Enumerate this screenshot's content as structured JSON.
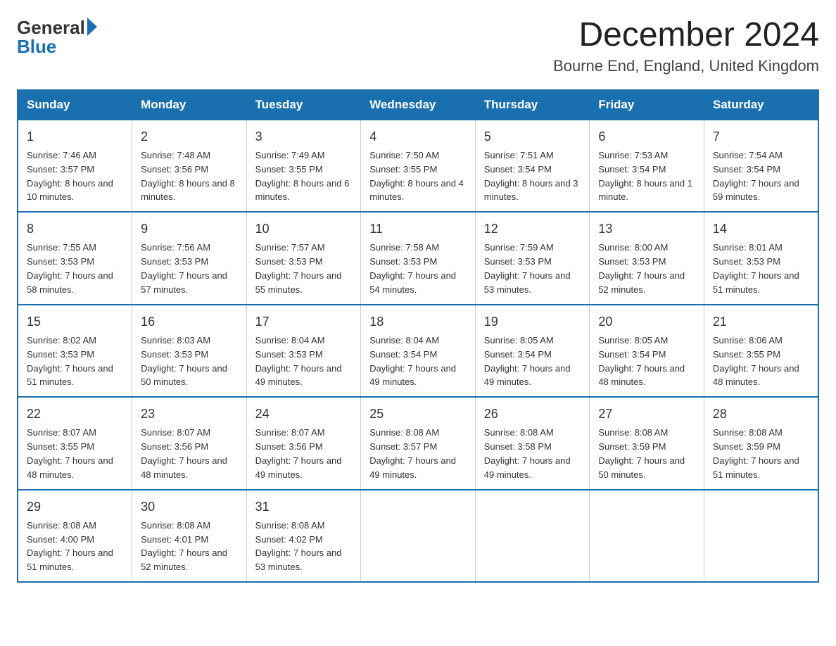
{
  "logo": {
    "general": "General",
    "blue": "Blue",
    "arrow": "▶"
  },
  "header": {
    "month_title": "December 2024",
    "location": "Bourne End, England, United Kingdom"
  },
  "days_of_week": [
    "Sunday",
    "Monday",
    "Tuesday",
    "Wednesday",
    "Thursday",
    "Friday",
    "Saturday"
  ],
  "weeks": [
    [
      {
        "day": "1",
        "sunrise": "7:46 AM",
        "sunset": "3:57 PM",
        "daylight": "8 hours and 10 minutes."
      },
      {
        "day": "2",
        "sunrise": "7:48 AM",
        "sunset": "3:56 PM",
        "daylight": "8 hours and 8 minutes."
      },
      {
        "day": "3",
        "sunrise": "7:49 AM",
        "sunset": "3:55 PM",
        "daylight": "8 hours and 6 minutes."
      },
      {
        "day": "4",
        "sunrise": "7:50 AM",
        "sunset": "3:55 PM",
        "daylight": "8 hours and 4 minutes."
      },
      {
        "day": "5",
        "sunrise": "7:51 AM",
        "sunset": "3:54 PM",
        "daylight": "8 hours and 3 minutes."
      },
      {
        "day": "6",
        "sunrise": "7:53 AM",
        "sunset": "3:54 PM",
        "daylight": "8 hours and 1 minute."
      },
      {
        "day": "7",
        "sunrise": "7:54 AM",
        "sunset": "3:54 PM",
        "daylight": "7 hours and 59 minutes."
      }
    ],
    [
      {
        "day": "8",
        "sunrise": "7:55 AM",
        "sunset": "3:53 PM",
        "daylight": "7 hours and 58 minutes."
      },
      {
        "day": "9",
        "sunrise": "7:56 AM",
        "sunset": "3:53 PM",
        "daylight": "7 hours and 57 minutes."
      },
      {
        "day": "10",
        "sunrise": "7:57 AM",
        "sunset": "3:53 PM",
        "daylight": "7 hours and 55 minutes."
      },
      {
        "day": "11",
        "sunrise": "7:58 AM",
        "sunset": "3:53 PM",
        "daylight": "7 hours and 54 minutes."
      },
      {
        "day": "12",
        "sunrise": "7:59 AM",
        "sunset": "3:53 PM",
        "daylight": "7 hours and 53 minutes."
      },
      {
        "day": "13",
        "sunrise": "8:00 AM",
        "sunset": "3:53 PM",
        "daylight": "7 hours and 52 minutes."
      },
      {
        "day": "14",
        "sunrise": "8:01 AM",
        "sunset": "3:53 PM",
        "daylight": "7 hours and 51 minutes."
      }
    ],
    [
      {
        "day": "15",
        "sunrise": "8:02 AM",
        "sunset": "3:53 PM",
        "daylight": "7 hours and 51 minutes."
      },
      {
        "day": "16",
        "sunrise": "8:03 AM",
        "sunset": "3:53 PM",
        "daylight": "7 hours and 50 minutes."
      },
      {
        "day": "17",
        "sunrise": "8:04 AM",
        "sunset": "3:53 PM",
        "daylight": "7 hours and 49 minutes."
      },
      {
        "day": "18",
        "sunrise": "8:04 AM",
        "sunset": "3:54 PM",
        "daylight": "7 hours and 49 minutes."
      },
      {
        "day": "19",
        "sunrise": "8:05 AM",
        "sunset": "3:54 PM",
        "daylight": "7 hours and 49 minutes."
      },
      {
        "day": "20",
        "sunrise": "8:05 AM",
        "sunset": "3:54 PM",
        "daylight": "7 hours and 48 minutes."
      },
      {
        "day": "21",
        "sunrise": "8:06 AM",
        "sunset": "3:55 PM",
        "daylight": "7 hours and 48 minutes."
      }
    ],
    [
      {
        "day": "22",
        "sunrise": "8:07 AM",
        "sunset": "3:55 PM",
        "daylight": "7 hours and 48 minutes."
      },
      {
        "day": "23",
        "sunrise": "8:07 AM",
        "sunset": "3:56 PM",
        "daylight": "7 hours and 48 minutes."
      },
      {
        "day": "24",
        "sunrise": "8:07 AM",
        "sunset": "3:56 PM",
        "daylight": "7 hours and 49 minutes."
      },
      {
        "day": "25",
        "sunrise": "8:08 AM",
        "sunset": "3:57 PM",
        "daylight": "7 hours and 49 minutes."
      },
      {
        "day": "26",
        "sunrise": "8:08 AM",
        "sunset": "3:58 PM",
        "daylight": "7 hours and 49 minutes."
      },
      {
        "day": "27",
        "sunrise": "8:08 AM",
        "sunset": "3:59 PM",
        "daylight": "7 hours and 50 minutes."
      },
      {
        "day": "28",
        "sunrise": "8:08 AM",
        "sunset": "3:59 PM",
        "daylight": "7 hours and 51 minutes."
      }
    ],
    [
      {
        "day": "29",
        "sunrise": "8:08 AM",
        "sunset": "4:00 PM",
        "daylight": "7 hours and 51 minutes."
      },
      {
        "day": "30",
        "sunrise": "8:08 AM",
        "sunset": "4:01 PM",
        "daylight": "7 hours and 52 minutes."
      },
      {
        "day": "31",
        "sunrise": "8:08 AM",
        "sunset": "4:02 PM",
        "daylight": "7 hours and 53 minutes."
      },
      null,
      null,
      null,
      null
    ]
  ]
}
